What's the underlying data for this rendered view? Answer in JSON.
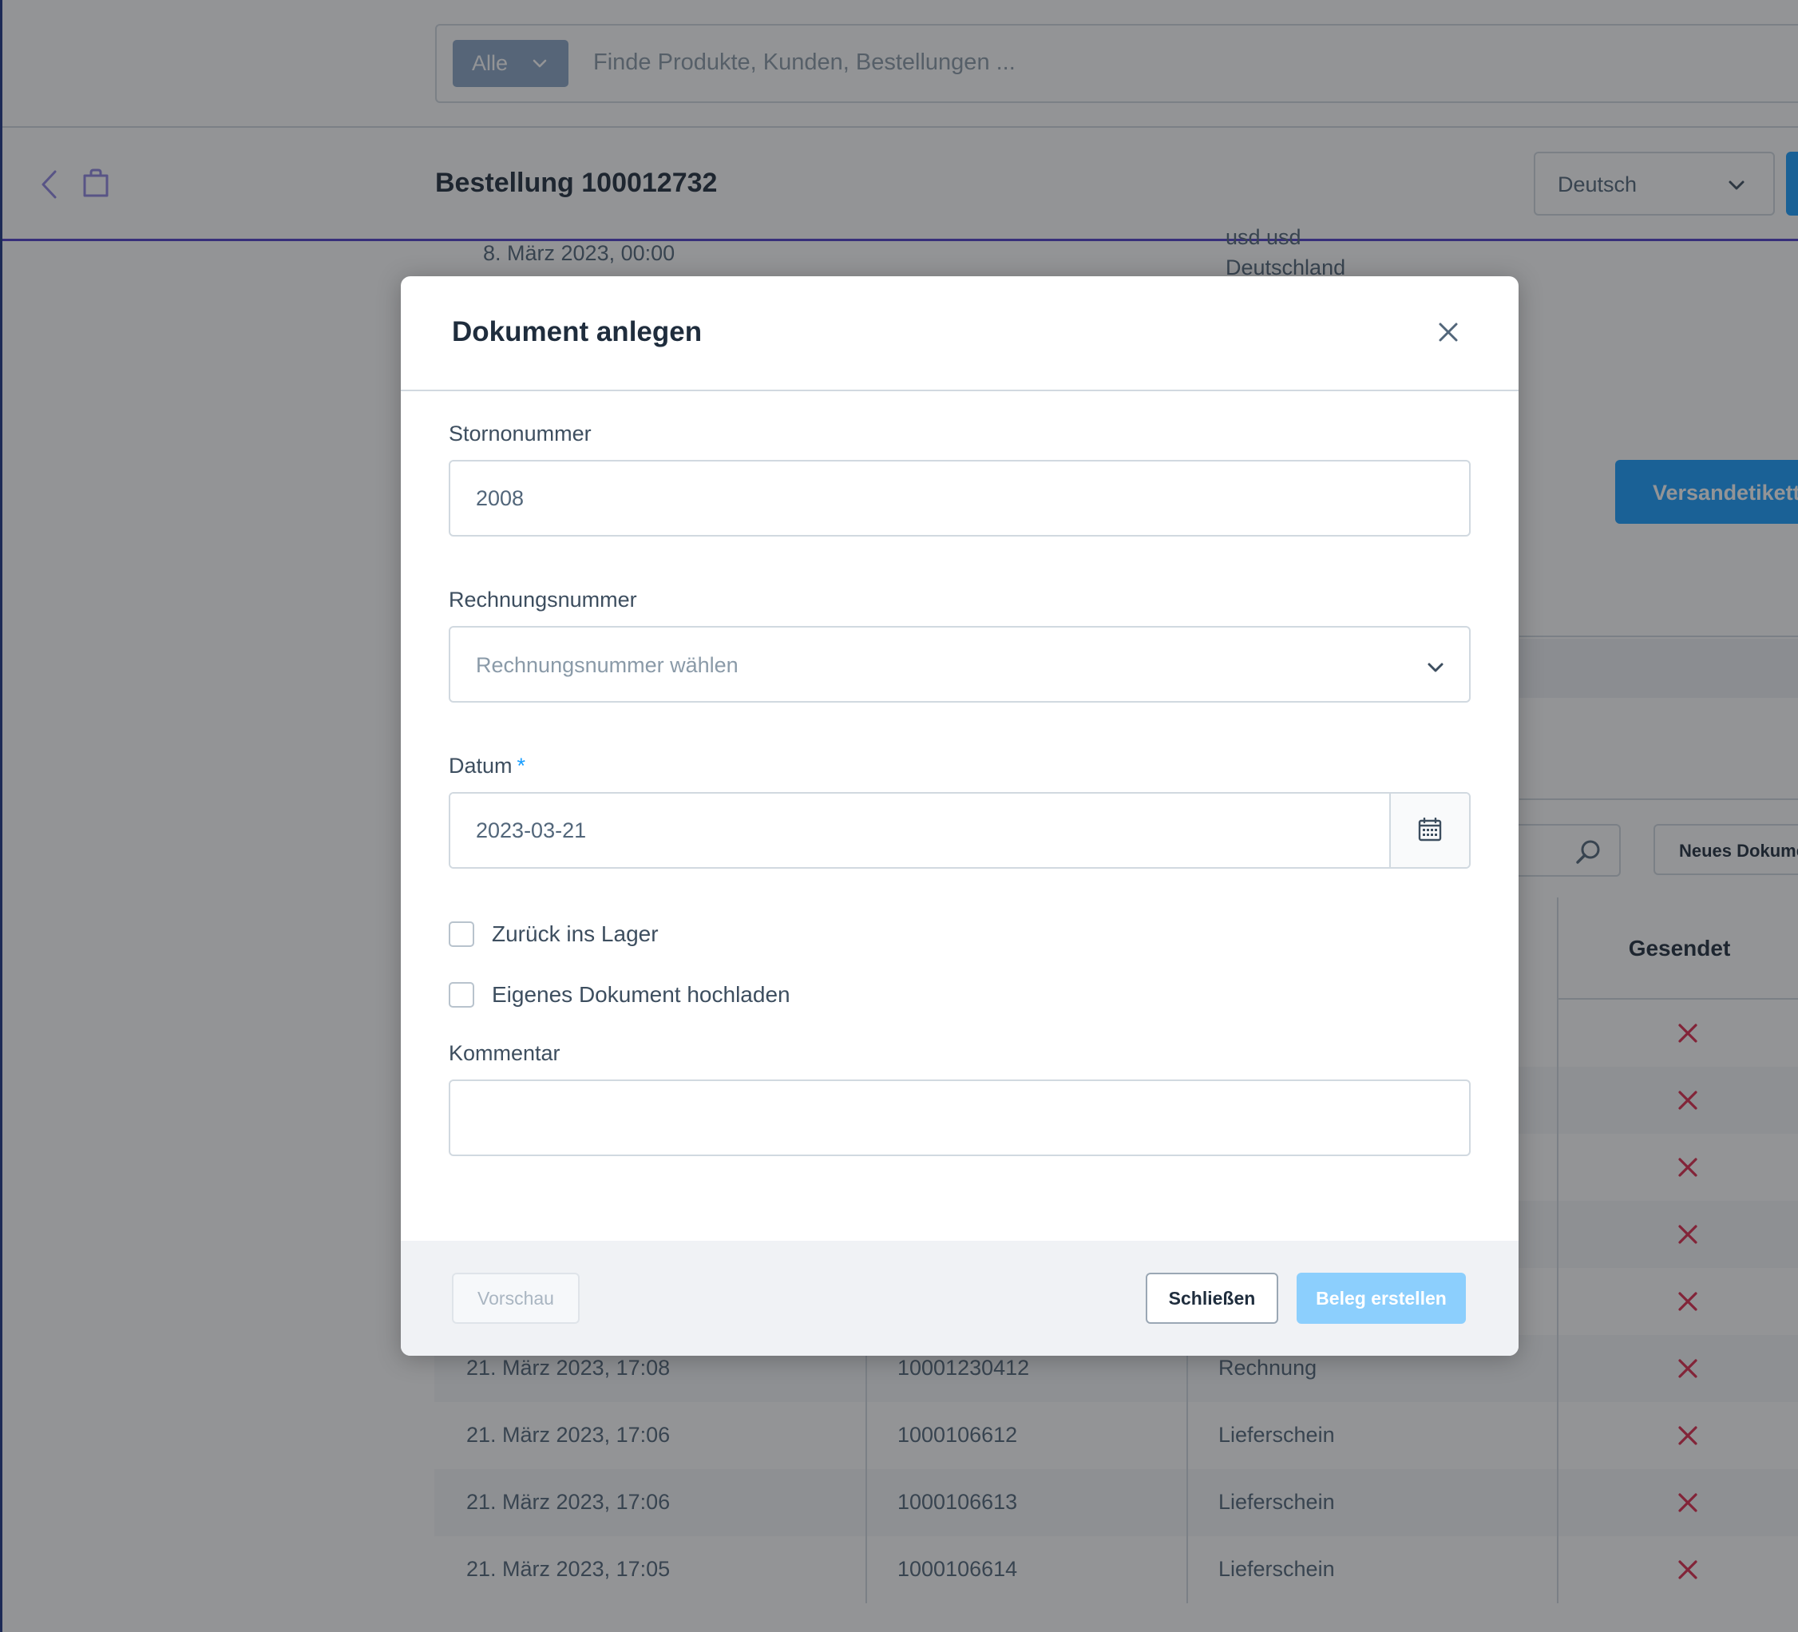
{
  "search": {
    "scope_label": "Alle",
    "placeholder": "Finde Produkte, Kunden, Bestellungen ..."
  },
  "header": {
    "title": "Bestellung 100012732",
    "language": "Deutsch"
  },
  "order_info": {
    "date": "8. März 2023, 00:00",
    "address_line_cut": "usd usd",
    "country": "Deutschland"
  },
  "actions": {
    "shipping_label_button": "Versandetikett e",
    "new_document_button": "Neues Dokume"
  },
  "documents_table": {
    "sent_header": "Gesendet",
    "rows": [
      {
        "date": "",
        "number": "",
        "type": "",
        "sent": false
      },
      {
        "date": "",
        "number": "",
        "type": "",
        "sent": false
      },
      {
        "date": "",
        "number": "",
        "type": "",
        "sent": false
      },
      {
        "date": "",
        "number": "",
        "type": "",
        "sent": false
      },
      {
        "date": "",
        "number": "",
        "type": "",
        "sent": false
      },
      {
        "date": "21. März 2023, 17:08",
        "number": "10001230412",
        "type": "Rechnung",
        "sent": false
      },
      {
        "date": "21. März 2023, 17:06",
        "number": "1000106612",
        "type": "Lieferschein",
        "sent": false
      },
      {
        "date": "21. März 2023, 17:06",
        "number": "1000106613",
        "type": "Lieferschein",
        "sent": false
      },
      {
        "date": "21. März 2023, 17:05",
        "number": "1000106614",
        "type": "Lieferschein",
        "sent": false
      }
    ]
  },
  "modal": {
    "title": "Dokument anlegen",
    "storno": {
      "label": "Stornonummer",
      "value": "2008"
    },
    "invoice": {
      "label": "Rechnungsnummer",
      "placeholder": "Rechnungsnummer wählen"
    },
    "date": {
      "label": "Datum",
      "required_mark": "*",
      "value": "2023-03-21"
    },
    "return_to_stock": {
      "label": "Zurück ins Lager",
      "checked": false
    },
    "upload_own": {
      "label": "Eigenes Dokument hochladen",
      "checked": false
    },
    "comment": {
      "label": "Kommentar",
      "value": ""
    },
    "buttons": {
      "preview": "Vorschau",
      "close": "Schließen",
      "create": "Beleg erstellen"
    }
  },
  "colors": {
    "primary": "#189eff",
    "primary_disabled": "#8ccffd",
    "accent_line": "#4f3fc9",
    "danger": "#de294c",
    "text_dark": "#1f2d3d"
  }
}
